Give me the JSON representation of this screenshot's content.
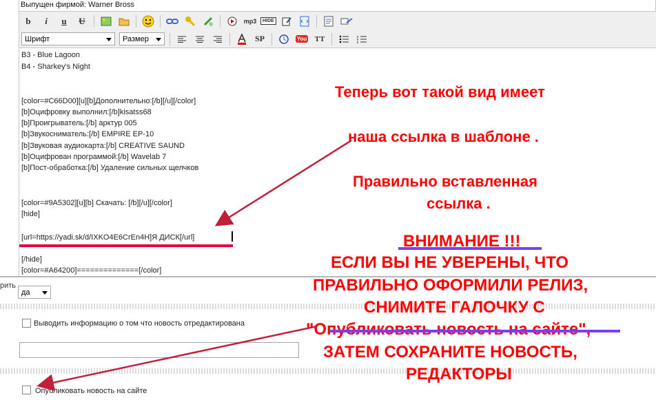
{
  "header": {
    "publisher": "Выпущен фирмой: Warner Bross"
  },
  "toolbar": {
    "font_select": "Шрифт",
    "size_select": "Размер",
    "mp3_label": "mp3",
    "hide_label": "HIDE",
    "sp_label": "SP",
    "tt_label": "TT",
    "youtube_label": "You"
  },
  "editor": {
    "lines": [
      "B3 - Blue Lagoon",
      "B4 - Sharkey's Night",
      "[color=#C66D00][u][b]Дополнительно:[/b][/u][/color]",
      "[b]Оцифровку выполнил:[/b]kisatss68",
      "[b]Проигрыватель:[/b]  арктур 005",
      "[b]Звукосниматель:[/b] EMPIRE EP-10",
      "[b]Звуковая аудиокарта:[/b] CREATIVE SAUND",
      "[b]Оцифрован программой:[/b] Wavelab 7",
      "[b]Пост-обработка:[/b] Удаление сильных щелчков",
      "[color=#9A5302][u][b] Скачать: [/b][/u][/color]",
      "[hide]",
      "[url=https://yadi.sk/d/IXKO4E6CrEn4H]Я ДИСК[/url]",
      "[/hide]",
      "[color=#A64200]==============[/color]"
    ]
  },
  "form": {
    "left_label_fragment": "рить",
    "select_value": "да",
    "checkbox1_label": "Выводить информацию о том что новость отредактирована",
    "text_input_value": "",
    "checkbox2_label": "Опубликовать новость на сайте"
  },
  "annotation": {
    "line1": "Теперь вот такой вид имеет",
    "line2": "наша ссылка в шаблоне .",
    "line3": "Правильно вставленная",
    "line4": "ссылка .",
    "warning": "ВНИМАНИЕ !!!",
    "w1": "ЕСЛИ ВЫ НЕ УВЕРЕНЫ, ЧТО",
    "w2": "ПРАВИЛЬНО ОФОРМИЛИ РЕЛИЗ,",
    "w3": "СНИМИТЕ ГАЛОЧКУ  С",
    "w4": "\"Опубликовать новость на сайте\",",
    "w5": "ЗАТЕМ СОХРАНИТЕ НОВОСТЬ,",
    "w6": "РЕДАКТОРЫ"
  },
  "colors": {
    "annotation_red": "#ff0000",
    "underline_red": "#e8003a",
    "underline_purple": "#7b3cff",
    "arrow": "#c0203a"
  }
}
